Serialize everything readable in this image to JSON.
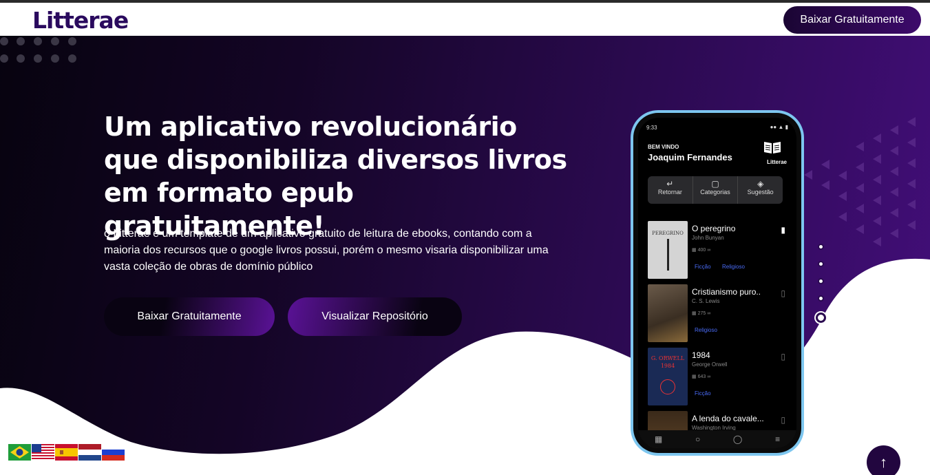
{
  "navbar": {
    "logo": "Litterae",
    "download_label": "Baixar Gratuitamente"
  },
  "hero": {
    "headline": "Um aplicativo revolucionário que disponibiliza diversos livros em formato epub gratuitamente!",
    "description": "o Litterae é um template de um aplicativo gratuito de leitura de ebooks, contando com a maioria dos recursos que o google livros possui, porém o mesmo visaria disponibilizar uma vasta coleção de obras de domínio público",
    "primary_button": "Baixar Gratuitamente",
    "secondary_button": "Visualizar Repositório"
  },
  "carousel": {
    "count": 5,
    "active_index": 4
  },
  "languages": [
    "pt-BR",
    "en-US",
    "es",
    "nl",
    "ru"
  ],
  "phone": {
    "status_time": "9:33",
    "welcome": "BEM VINDO",
    "user": "Joaquim Fernandes",
    "brand": "Litterae",
    "tabs": [
      {
        "label": "Retornar",
        "icon": "return-icon"
      },
      {
        "label": "Categorias",
        "icon": "folder-icon"
      },
      {
        "label": "Sugestão",
        "icon": "suggestion-icon"
      }
    ],
    "books": [
      {
        "title": "O peregrino",
        "author": "John Bunyan",
        "pages": "400",
        "tags": [
          "Ficção",
          "Religioso"
        ],
        "saved": true,
        "cover_text": "PEREGRINO"
      },
      {
        "title": "Cristianismo puro..",
        "author": "C. S. Lewis",
        "pages": "275",
        "tags": [
          "Religioso"
        ],
        "saved": false,
        "cover_text": ""
      },
      {
        "title": "1984",
        "author": "George Orwell",
        "pages": "643",
        "tags": [
          "Ficção"
        ],
        "saved": false,
        "cover_text": "G. ORWELL 1984"
      },
      {
        "title": "A lenda do cavale...",
        "author": "Washington Irving",
        "pages": "",
        "tags": [],
        "saved": false,
        "cover_text": ""
      }
    ]
  },
  "colors": {
    "brand": "#2a0a5e",
    "hero_dark": "#07030f",
    "hero_purple": "#430e7a",
    "phone_frame": "#7dc6ef",
    "tag_blue": "#4a6cf7"
  }
}
